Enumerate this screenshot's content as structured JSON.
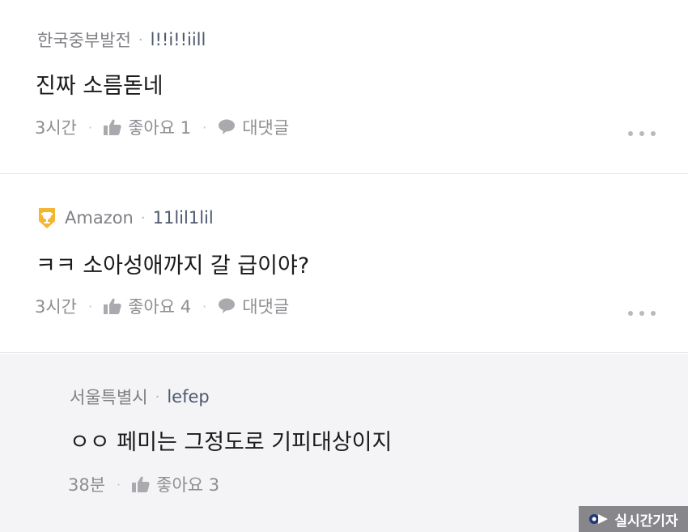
{
  "comments": [
    {
      "author": "한국중부발전",
      "user_id": "l!!i!!iill",
      "text": "진짜 소름돋네",
      "time": "3시간",
      "like_label": "좋아요 1",
      "reply_label": "대댓글"
    },
    {
      "author": "Amazon",
      "user_id": "11lil1lil",
      "text": "ㅋㅋ 소아성애까지 갈 급이야?",
      "time": "3시간",
      "like_label": "좋아요 4",
      "reply_label": "대댓글",
      "badge_icon": "trophy-badge-icon"
    }
  ],
  "reply": {
    "author": "서울특별시",
    "user_id": "lefep",
    "text": "ㅇㅇ 페미는 그정도로 기피대상이지",
    "time": "38분",
    "like_label": "좋아요 3"
  },
  "separator": "·",
  "watermark": "실시간기자",
  "colors": {
    "author_gray": "#808085",
    "user_id_navy": "#4d586e",
    "reply_background": "#f4f4f6",
    "badge_gold": "#f2b632"
  },
  "icons": [
    "thumbs-up-icon",
    "speech-bubble-icon",
    "more-options-icon",
    "trophy-badge-icon"
  ]
}
